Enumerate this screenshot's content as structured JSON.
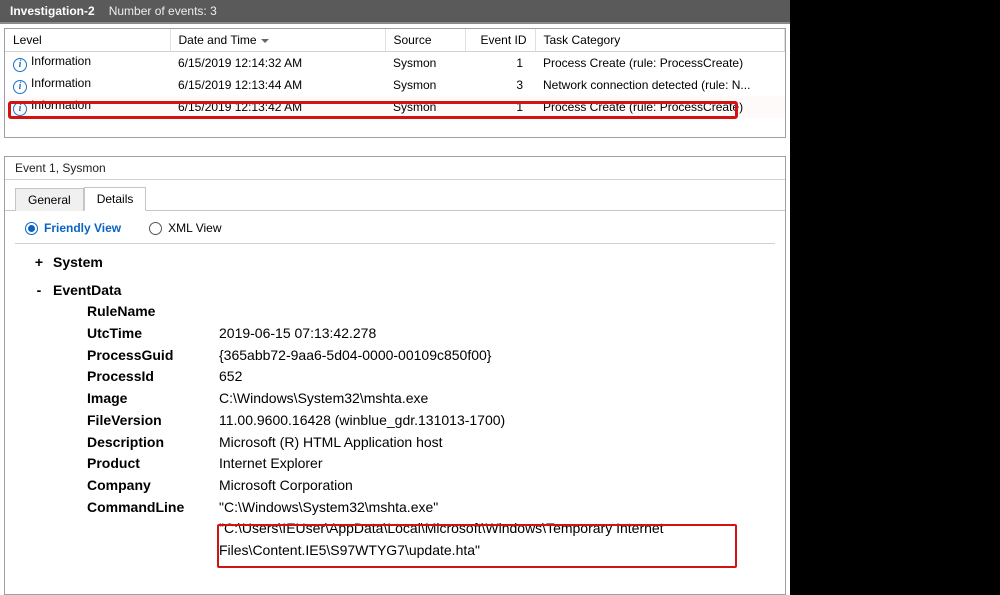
{
  "title_bar": {
    "title": "Investigation-2",
    "subtitle": "Number of events: 3"
  },
  "columns": {
    "level": "Level",
    "date": "Date and Time",
    "source": "Source",
    "event_id": "Event ID",
    "task": "Task Category"
  },
  "events": [
    {
      "level": "Information",
      "date": "6/15/2019 12:14:32 AM",
      "source": "Sysmon",
      "event_id": "1",
      "task": "Process Create (rule: ProcessCreate)"
    },
    {
      "level": "Information",
      "date": "6/15/2019 12:13:44 AM",
      "source": "Sysmon",
      "event_id": "3",
      "task": "Network connection detected (rule: N..."
    },
    {
      "level": "Information",
      "date": "6/15/2019 12:13:42 AM",
      "source": "Sysmon",
      "event_id": "1",
      "task": "Process Create (rule: ProcessCreate)"
    }
  ],
  "detail": {
    "header": "Event 1, Sysmon",
    "tabs": {
      "general": "General",
      "details": "Details"
    },
    "views": {
      "friendly": "Friendly View",
      "xml": "XML View"
    },
    "nodes": {
      "system": "System",
      "eventdata": "EventData"
    },
    "fields": [
      {
        "k": "RuleName",
        "v": ""
      },
      {
        "k": "UtcTime",
        "v": "2019-06-15 07:13:42.278"
      },
      {
        "k": "ProcessGuid",
        "v": "{365abb72-9aa6-5d04-0000-00109c850f00}"
      },
      {
        "k": "ProcessId",
        "v": "652"
      },
      {
        "k": "Image",
        "v": "C:\\Windows\\System32\\mshta.exe"
      },
      {
        "k": "FileVersion",
        "v": "11.00.9600.16428 (winblue_gdr.131013-1700)"
      },
      {
        "k": "Description",
        "v": "Microsoft (R) HTML Application host"
      },
      {
        "k": "Product",
        "v": "Internet Explorer"
      },
      {
        "k": "Company",
        "v": "Microsoft Corporation"
      },
      {
        "k": "CommandLine",
        "v": "\"C:\\Windows\\System32\\mshta.exe\" \"C:\\Users\\IEUser\\AppData\\Local\\Microsoft\\Windows\\Temporary Internet Files\\Content.IE5\\S97WTYG7\\update.hta\""
      }
    ]
  }
}
